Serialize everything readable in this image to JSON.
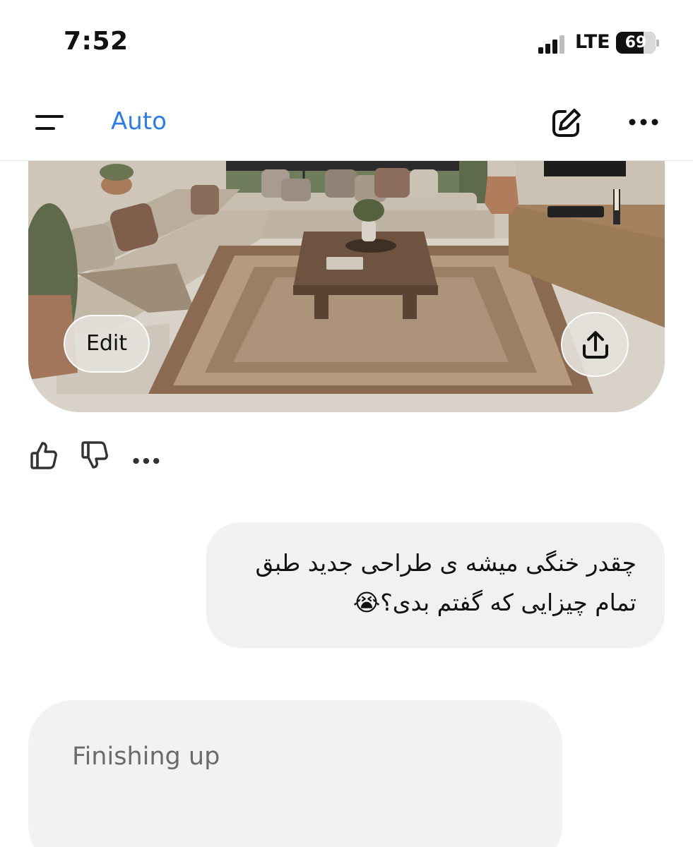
{
  "status_bar": {
    "time": "7:52",
    "network": "LTE",
    "battery_level": "69",
    "battery_fraction": 0.69
  },
  "nav": {
    "model_label": "Auto",
    "icons": [
      "menu-icon",
      "new-chat-icon",
      "more-icon"
    ],
    "accent_color": "#2f7de1"
  },
  "image_card": {
    "edit_label": "Edit",
    "share_icon": "share-icon"
  },
  "actions": {
    "icons": [
      "thumbs-up-icon",
      "thumbs-down-icon",
      "more-icon"
    ]
  },
  "user_message": {
    "line1": "چقدر خنگی میشه ی طراحی جدید طبق",
    "line2": "تمام چیزایی که گفتم بدی؟😭"
  },
  "assistant": {
    "status": "Finishing up"
  }
}
